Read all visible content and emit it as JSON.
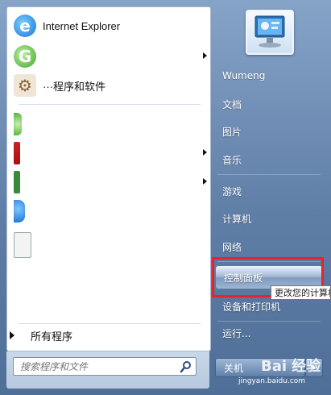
{
  "left": {
    "programs": [
      {
        "label": "Internet Explorer",
        "icon": "ie-icon",
        "has_arrow": false
      },
      {
        "label": "",
        "icon": "green-app-icon",
        "has_arrow": true
      },
      {
        "label": "···程序和软件",
        "icon": "tools-icon",
        "has_arrow": false
      },
      {
        "label": "",
        "icon": "green-app-icon",
        "has_arrow": false
      },
      {
        "label": "",
        "icon": "media-icon",
        "has_arrow": true
      },
      {
        "label": "",
        "icon": "app-icon",
        "has_arrow": true
      },
      {
        "label": "",
        "icon": "blue-app-icon",
        "has_arrow": false
      },
      {
        "label": "",
        "icon": "document-icon",
        "has_arrow": false
      }
    ],
    "all_programs": "所有程序",
    "search_placeholder": "搜索程序和文件"
  },
  "right": {
    "username": "Wumeng",
    "items": [
      "文档",
      "图片",
      "音乐",
      "游戏",
      "计算机",
      "网络",
      "控制面板",
      "设备和打印机",
      "运行..."
    ],
    "tooltip": "更改您的计算机",
    "shutdown": "关机"
  },
  "watermark": {
    "text": "Bai 经验",
    "sub": "jingyan.baidu.com"
  },
  "colors": {
    "highlight_border": "#e8212c",
    "panel_bg": "#ffffff",
    "right_bg": "#5f7ea6"
  }
}
